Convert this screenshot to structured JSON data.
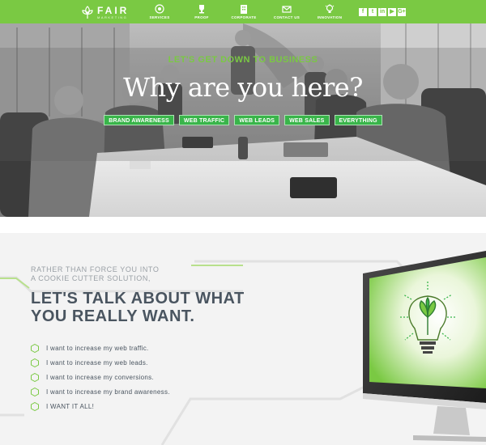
{
  "nav": {
    "brand": "FAIR",
    "brand_sub": "MARKETING",
    "items": [
      {
        "label": "SERVICES",
        "icon": "target-icon"
      },
      {
        "label": "PROOF",
        "icon": "trophy-icon"
      },
      {
        "label": "CORPORATE",
        "icon": "building-icon"
      },
      {
        "label": "CONTACT US",
        "icon": "envelope-icon"
      },
      {
        "label": "INNOVATION",
        "icon": "lightbulb-icon"
      }
    ],
    "social": [
      "f",
      "t",
      "in",
      "▶",
      "G+"
    ]
  },
  "hero": {
    "kicker": "LET'S GET DOWN TO BUSINESS",
    "title": "Why are you here?",
    "tags": [
      "BRAND AWARENESS",
      "WEB TRAFFIC",
      "WEB LEADS",
      "WEB SALES",
      "EVERYTHING"
    ]
  },
  "section": {
    "intro_line1": "RATHER THAN FORCE YOU INTO",
    "intro_line2": "A COOKIE CUTTER SOLUTION,",
    "headline_line1": "LET'S TALK ABOUT WHAT",
    "headline_line2": "YOU REALLY WANT.",
    "wants": [
      "I want to increase my web traffic.",
      "I want to increase my web leads.",
      "I want to increase my conversions.",
      "I want to increase my brand awareness.",
      "I WANT IT ALL!"
    ]
  },
  "colors": {
    "brand_green": "#7ac943",
    "tag_green": "#39b54a",
    "heading_gray": "#4a5560"
  }
}
